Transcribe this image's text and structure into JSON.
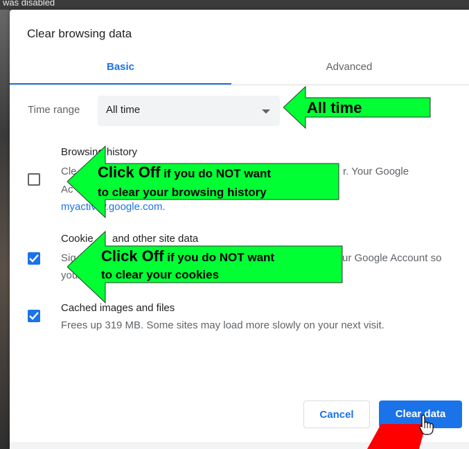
{
  "background": {
    "top_text": "was disabled"
  },
  "dialog": {
    "title": "Clear browsing data",
    "tabs": [
      {
        "label": "Basic",
        "active": true
      },
      {
        "label": "Advanced",
        "active": false
      }
    ],
    "time_range": {
      "label": "Time range",
      "value": "All time"
    },
    "options": [
      {
        "title": "Browsing history",
        "checked": false,
        "desc_line1": "Cle",
        "desc_line1_tail": "r. Your Google",
        "desc_line2": "Ac",
        "desc_link": "myactivity.google.com."
      },
      {
        "title": "Cookies and other site data",
        "title_visible_a": "Cookie",
        "title_visible_b": "and other site data",
        "checked": true,
        "desc_line1": "Sig",
        "desc_line1_tail": "ur Google Account so",
        "desc_line2": "your"
      },
      {
        "title": "Cached images and files",
        "checked": true,
        "desc": "Frees up 319 MB. Some sites may load more slowly on your next visit."
      }
    ],
    "buttons": {
      "cancel": "Cancel",
      "clear": "Clear data"
    }
  },
  "annotations": {
    "time_range": "All time",
    "history_big": "Click Off",
    "history_small": " if you do NOT want",
    "history_line2": "to clear your browsing history",
    "cookies_big": "Click Off",
    "cookies_small": " if you do NOT want",
    "cookies_line2": "to clear your cookies"
  },
  "colors": {
    "accent": "#1a73e8",
    "annotation_fill": "#00ff33",
    "annotation_pointer": "#ff0000"
  }
}
